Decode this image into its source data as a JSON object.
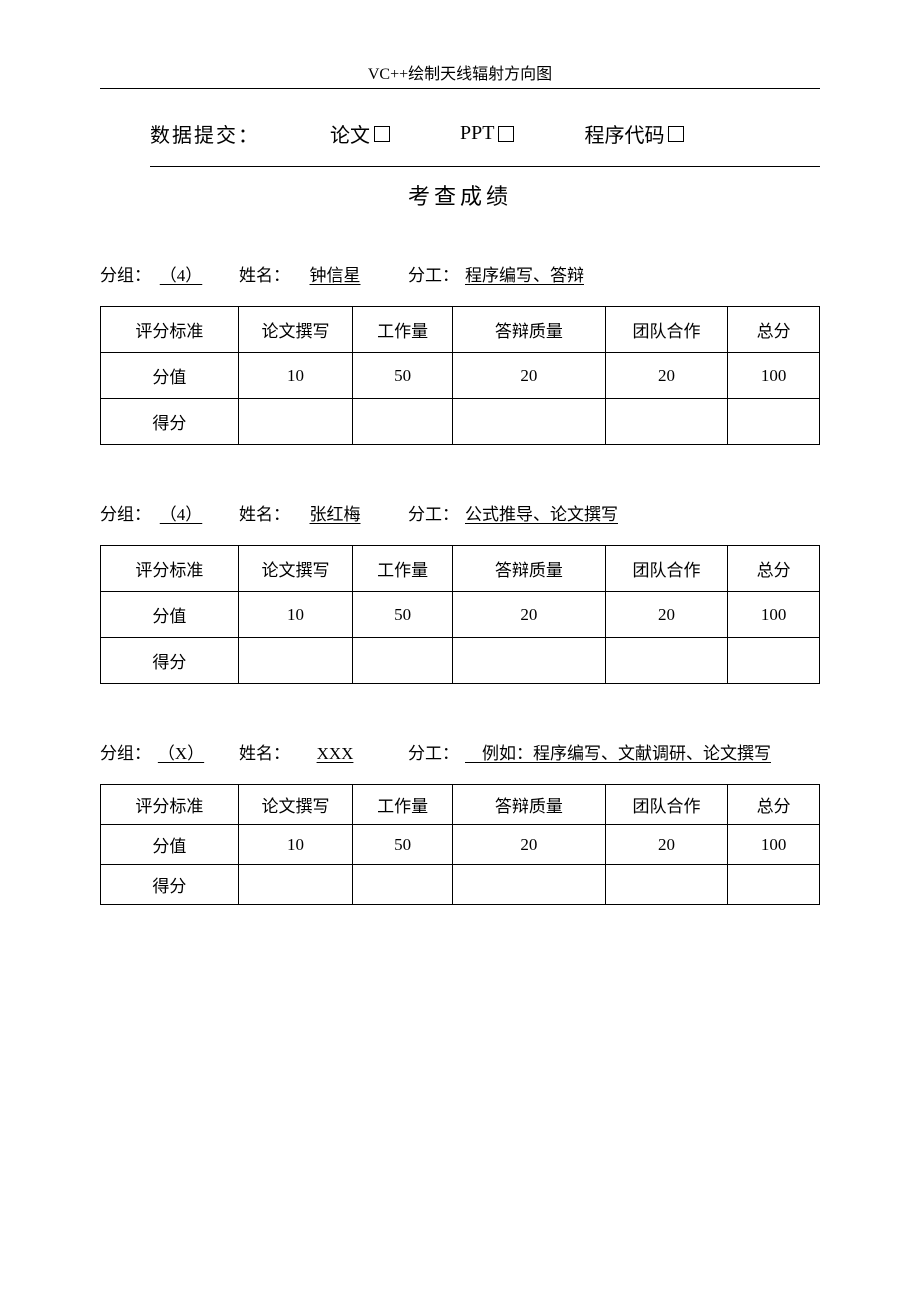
{
  "header": {
    "title": "VC++绘制天线辐射方向图"
  },
  "submit": {
    "label": "数据提交：",
    "items": [
      {
        "label": "论文"
      },
      {
        "label": "PPT"
      },
      {
        "label": "程序代码"
      }
    ]
  },
  "examTitle": "考查成绩",
  "labels": {
    "group": "分组：",
    "name": "姓名：",
    "task": "分工："
  },
  "tableHeaders": {
    "criteria": "评分标准",
    "paper": "论文撰写",
    "workload": "工作量",
    "defense": "答辩质量",
    "team": "团队合作",
    "total": "总分"
  },
  "tableRows": {
    "maxLabel": "分值",
    "scoreLabel": "得分"
  },
  "scoreValues": {
    "paper": "10",
    "workload": "50",
    "defense": "20",
    "team": "20",
    "total": "100"
  },
  "students": [
    {
      "group": "（4）",
      "name": "钟信星",
      "task": "程序编写、答辩"
    },
    {
      "group": "（4）",
      "name": "张红梅",
      "task": "公式推导、论文撰写"
    },
    {
      "group": "（X）",
      "name": "XXX",
      "task": "　例如：程序编写、文献调研、论文撰写"
    }
  ]
}
